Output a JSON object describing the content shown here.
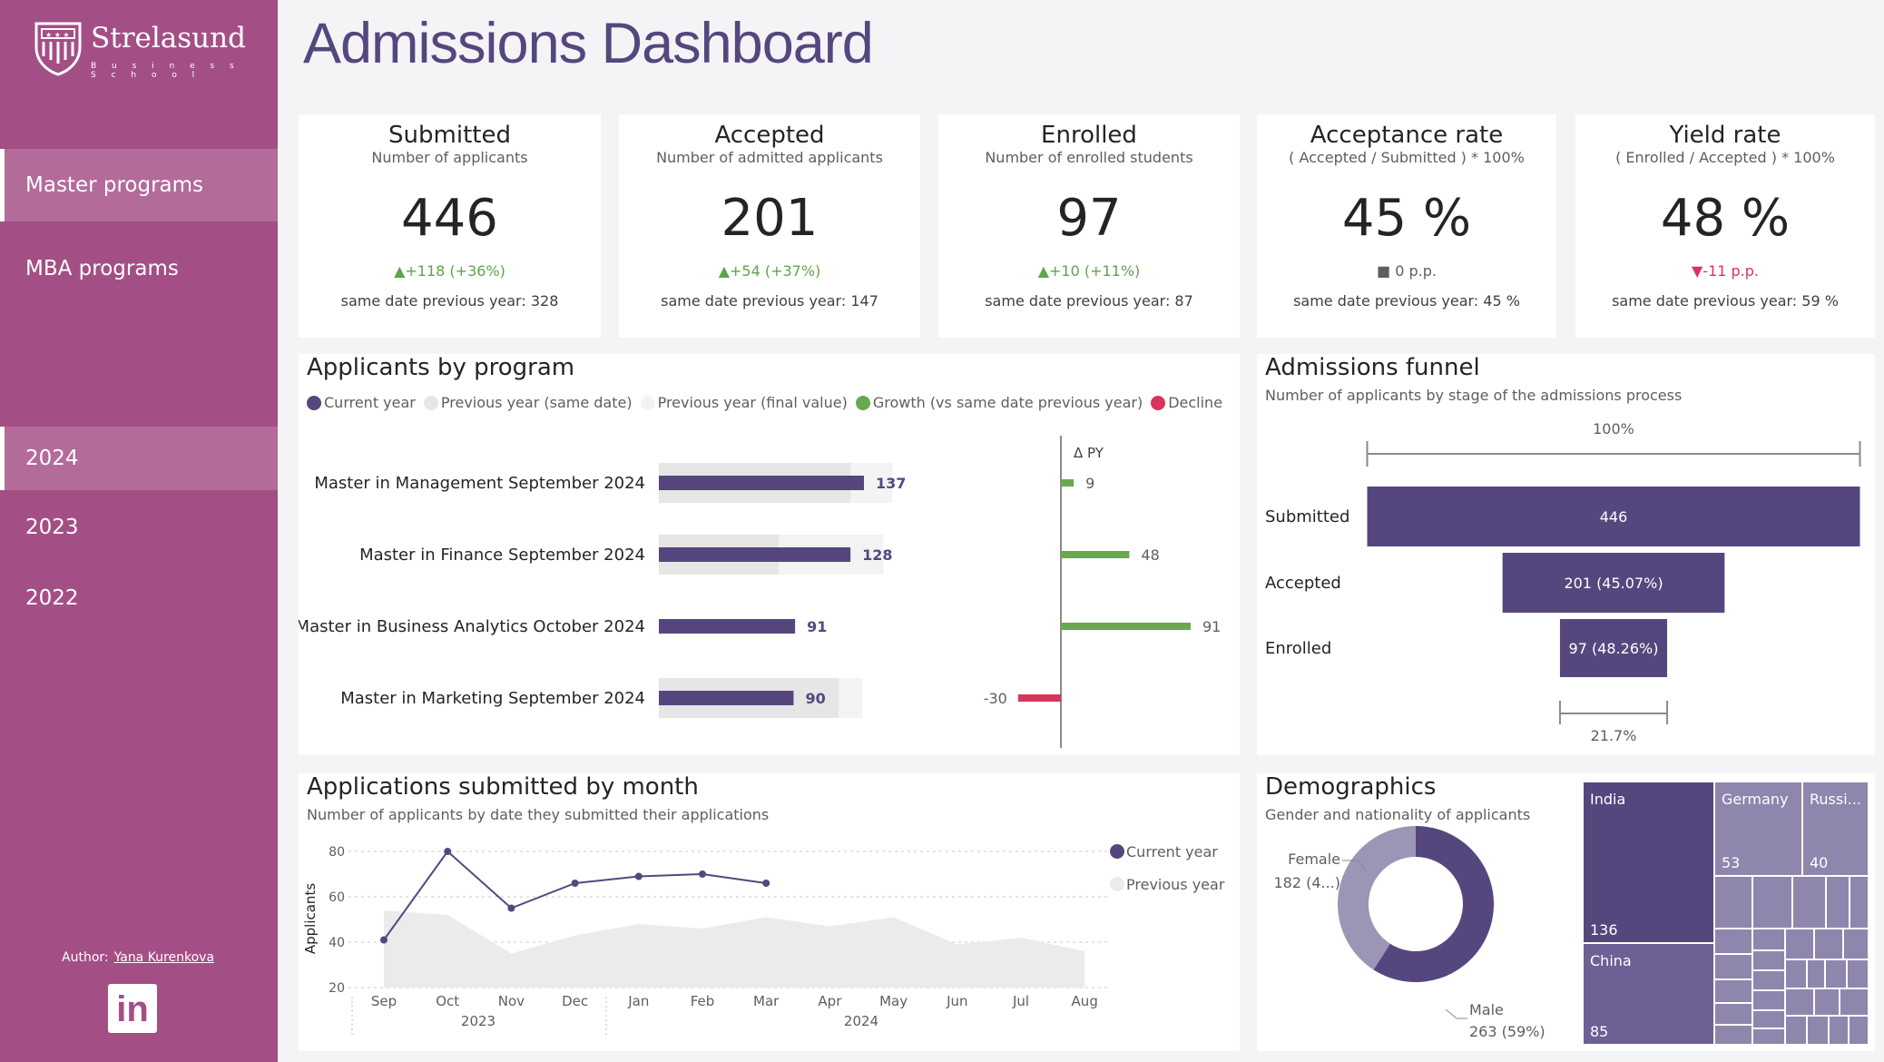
{
  "brand": {
    "name": "Strelasund",
    "tagline": "B u s i n e s s   S c h o o l"
  },
  "nav": {
    "programs": [
      {
        "label": "Master programs",
        "active": true
      },
      {
        "label": "MBA programs",
        "active": false
      }
    ],
    "years": [
      {
        "label": "2024",
        "active": true
      },
      {
        "label": "2023",
        "active": false
      },
      {
        "label": "2022",
        "active": false
      }
    ]
  },
  "author": {
    "label": "Author:",
    "name": "Yana Kurenkova"
  },
  "icons": {
    "logo": "shield-logo-icon",
    "linkedin": "linkedin-icon",
    "up": "triangle-up-icon",
    "down": "triangle-down-icon",
    "flat": "square-icon"
  },
  "title": "Admissions Dashboard",
  "colors": {
    "sidebar": "#a44e86",
    "accent": "#55477e",
    "growth": "#6aa84f",
    "decline": "#d7355b",
    "title": "#55477e"
  },
  "kpis": [
    {
      "title": "Submitted",
      "subtitle": "Number of applicants",
      "value": "446",
      "delta": "▲+118 (+36%)",
      "trend": "up",
      "prev": "same date previous year: 328"
    },
    {
      "title": "Accepted",
      "subtitle": "Number of admitted applicants",
      "value": "201",
      "delta": "▲+54 (+37%)",
      "trend": "up",
      "prev": "same date previous year: 147"
    },
    {
      "title": "Enrolled",
      "subtitle": "Number of enrolled students",
      "value": "97",
      "delta": "▲+10 (+11%)",
      "trend": "up",
      "prev": "same date previous year: 87"
    },
    {
      "title": "Acceptance rate",
      "subtitle": "( Accepted / Submitted ) * 100%",
      "value": "45 %",
      "delta": "■ 0 p.p.",
      "trend": "flat",
      "prev": "same date previous year: 45 %"
    },
    {
      "title": "Yield rate",
      "subtitle": "( Enrolled / Accepted ) * 100%",
      "value": "48 %",
      "delta": "▼-11 p.p.",
      "trend": "down",
      "prev": "same date previous year: 59 %"
    }
  ],
  "programs_panel": {
    "title": "Applicants by program",
    "legend": [
      {
        "label": "Current year",
        "color": "#55477e"
      },
      {
        "label": "Previous year (same date)",
        "color": "#e6e6e6"
      },
      {
        "label": "Previous year (final value)",
        "color": "#f3f3f3"
      },
      {
        "label": "Growth (vs same date previous year)",
        "color": "#6aa84f"
      },
      {
        "label": "Decline",
        "color": "#d7355b"
      }
    ],
    "delta_header": "Δ PY"
  },
  "funnel_panel": {
    "title": "Admissions funnel",
    "subtitle": "Number of applicants by stage of the admissions process",
    "top_label": "100%",
    "bottom_label": "21.7%"
  },
  "months_panel": {
    "title": "Applications submitted by month",
    "subtitle": "Number of applicants by date they submitted their applications",
    "legend": [
      {
        "label": "Current year",
        "color": "#55477e"
      },
      {
        "label": "Previous year",
        "color": "#ebebeb"
      }
    ],
    "ylabel": "Applicants",
    "year_labels": [
      "2023",
      "2024"
    ]
  },
  "demo_panel": {
    "title": "Demographics",
    "subtitle": "Gender and nationality of applicants",
    "female_label": "Female",
    "female_value": "182 (4...)",
    "male_label": "Male",
    "male_value": "263 (59%)",
    "treemap": [
      {
        "name": "India",
        "value": "136"
      },
      {
        "name": "China",
        "value": "85"
      },
      {
        "name": "Germany",
        "value": "53"
      },
      {
        "name": "Russi...",
        "value": "40"
      }
    ]
  },
  "chart_data": [
    {
      "type": "bar",
      "title": "Applicants by program",
      "categories": [
        "Master in Management September 2024",
        "Master in Finance September 2024",
        "Master in Business Analytics October 2024",
        "Master in Marketing September 2024"
      ],
      "series": [
        {
          "name": "Current year",
          "values": [
            137,
            128,
            91,
            90
          ]
        },
        {
          "name": "Previous year (same date)",
          "values": [
            128,
            80,
            0,
            120
          ]
        },
        {
          "name": "Previous year (final value)",
          "values": [
            156,
            150,
            0,
            136
          ]
        },
        {
          "name": "Δ PY",
          "values": [
            9,
            48,
            91,
            -30
          ]
        }
      ]
    },
    {
      "type": "bar",
      "title": "Admissions funnel",
      "categories": [
        "Submitted",
        "Accepted",
        "Enrolled"
      ],
      "values": [
        446,
        201,
        97
      ],
      "labels": [
        "446",
        "201 (45.07%)",
        "97 (48.26%)"
      ]
    },
    {
      "type": "line",
      "title": "Applications submitted by month",
      "x": [
        "Sep",
        "Oct",
        "Nov",
        "Dec",
        "Jan",
        "Feb",
        "Mar",
        "Apr",
        "May",
        "Jun",
        "Jul",
        "Aug"
      ],
      "ylabel": "Applicants",
      "ylim": [
        20,
        80
      ],
      "yticks": [
        20,
        40,
        60,
        80
      ],
      "series": [
        {
          "name": "Current year",
          "values": [
            41,
            80,
            55,
            66,
            69,
            70,
            66,
            null,
            null,
            null,
            null,
            null
          ]
        },
        {
          "name": "Previous year",
          "values": [
            54,
            52,
            35,
            43,
            48,
            46,
            51,
            47,
            51,
            39,
            42,
            36
          ]
        }
      ]
    },
    {
      "type": "pie",
      "title": "Demographics",
      "categories": [
        "Female",
        "Male"
      ],
      "values": [
        182,
        263
      ]
    },
    {
      "type": "heatmap",
      "title": "Nationality",
      "categories": [
        "India",
        "China",
        "Germany",
        "Russi..."
      ],
      "values": [
        136,
        85,
        53,
        40
      ]
    }
  ]
}
